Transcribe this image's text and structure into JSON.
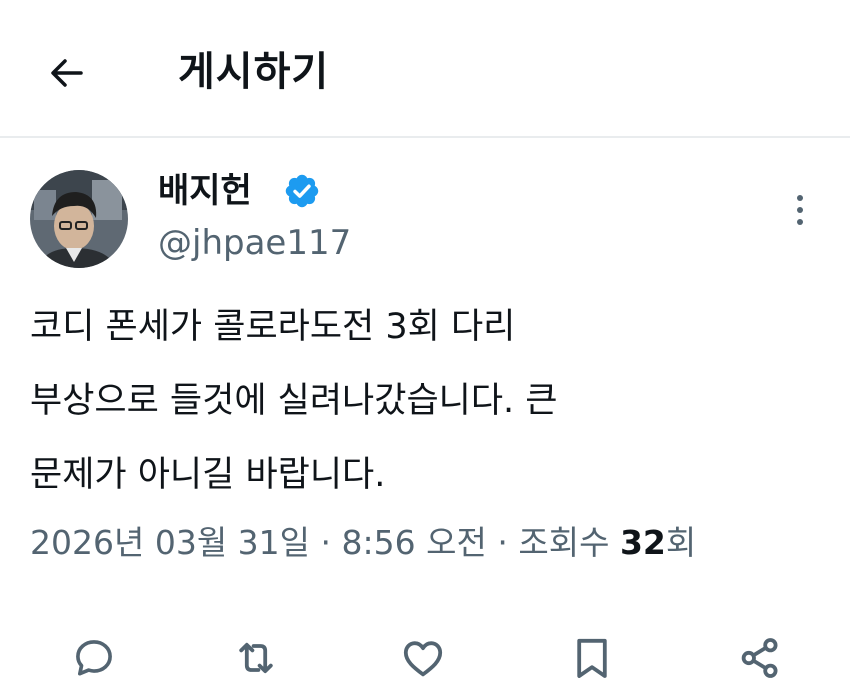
{
  "header": {
    "title": "게시하기",
    "back_icon": "arrow-left-icon"
  },
  "author": {
    "display_name": "배지헌",
    "handle": "@jhpae117",
    "verified_color": "#1d9bf0"
  },
  "tweet": {
    "lines": [
      "코디 폰세가 콜로라도전 3회 다리",
      "부상으로 들것에 실려나갔습니다. 큰",
      "문제가 아니길 바랍니다."
    ]
  },
  "meta": {
    "date": "2026년 03월 31일",
    "separator": "·",
    "time": "8:56 오전",
    "views_label": "조회수",
    "views_count": "32",
    "views_unit": "회"
  },
  "actions": {
    "icons": [
      "reply-icon",
      "retweet-icon",
      "like-icon",
      "bookmark-icon",
      "share-icon"
    ]
  },
  "colors": {
    "text_primary": "#0f1419",
    "text_secondary": "#536471",
    "divider": "#e9ecee"
  }
}
